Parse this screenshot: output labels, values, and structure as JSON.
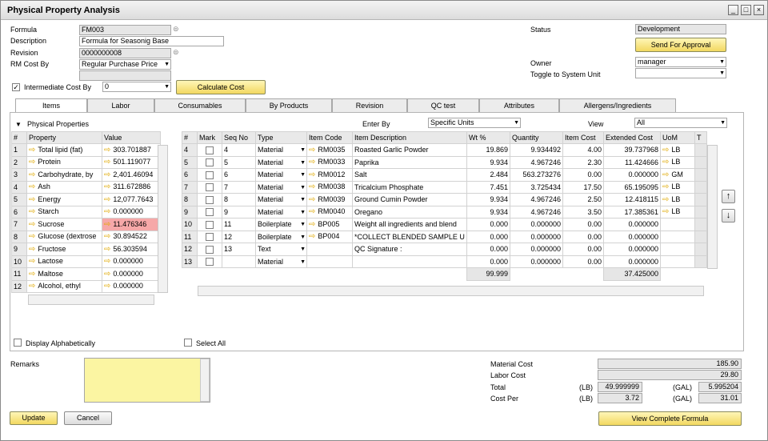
{
  "window": {
    "title": "Physical Property Analysis"
  },
  "header": {
    "formula_label": "Formula",
    "formula_value": "FM003",
    "description_label": "Description",
    "description_value": "Formula for Seasonig Base",
    "revision_label": "Revision",
    "revision_value": "0000000008",
    "rmcost_label": "RM Cost By",
    "rmcost_value": "Regular Purchase Price",
    "intermediate_label": "Intermediate Cost By",
    "intermediate_value": "0",
    "calc_button": "Calculate Cost",
    "status_label": "Status",
    "status_value": "Development",
    "send_button": "Send For Approval",
    "owner_label": "Owner",
    "owner_value": "manager",
    "toggle_label": "Toggle to System Unit",
    "toggle_value": ""
  },
  "tabs": [
    "Items",
    "Labor",
    "Consumables",
    "By Products",
    "Revision",
    "QC test",
    "Attributes",
    "Allergens/Ingredients"
  ],
  "props": {
    "section_label": "Physical Properties",
    "headers": [
      "#",
      "Property",
      "Value"
    ],
    "rows": [
      [
        "1",
        "Total lipid (fat)",
        "303.701887"
      ],
      [
        "2",
        "Protein",
        "501.119077"
      ],
      [
        "3",
        "Carbohydrate, by",
        "2,401.46094"
      ],
      [
        "4",
        "Ash",
        "311.672886"
      ],
      [
        "5",
        "Energy",
        "12,077.7643"
      ],
      [
        "6",
        "Starch",
        "0.000000"
      ],
      [
        "7",
        "Sucrose",
        "11.476346"
      ],
      [
        "8",
        "Glucose (dextrose",
        "30.894522"
      ],
      [
        "9",
        "Fructose",
        "56.303594"
      ],
      [
        "10",
        "Lactose",
        "0.000000"
      ],
      [
        "11",
        "Maltose",
        "0.000000"
      ],
      [
        "12",
        "Alcohol, ethyl",
        "0.000000"
      ]
    ],
    "display_alpha_label": "Display Alphabetically"
  },
  "items": {
    "enter_by_label": "Enter By",
    "enter_by_value": "Specific Units",
    "view_label": "View",
    "view_value": "All",
    "headers": [
      "#",
      "Mark",
      "Seq No",
      "Type",
      "Item Code",
      "Item Description",
      "Wt %",
      "Quantity",
      "Item Cost",
      "Extended Cost",
      "UoM",
      "T"
    ],
    "rows": [
      [
        "4",
        "",
        "4",
        "Material",
        "RM0035",
        "Roasted Garlic Powder",
        "19.869",
        "9.934492",
        "4.00",
        "39.737968",
        "LB"
      ],
      [
        "5",
        "",
        "5",
        "Material",
        "RM0033",
        "Paprika",
        "9.934",
        "4.967246",
        "2.30",
        "11.424666",
        "LB"
      ],
      [
        "6",
        "",
        "6",
        "Material",
        "RM0012",
        "Salt",
        "2.484",
        "563.273276",
        "0.00",
        "0.000000",
        "GM"
      ],
      [
        "7",
        "",
        "7",
        "Material",
        "RM0038",
        "Tricalcium Phosphate",
        "7.451",
        "3.725434",
        "17.50",
        "65.195095",
        "LB"
      ],
      [
        "8",
        "",
        "8",
        "Material",
        "RM0039",
        "Ground Cumin Powder",
        "9.934",
        "4.967246",
        "2.50",
        "12.418115",
        "LB"
      ],
      [
        "9",
        "",
        "9",
        "Material",
        "RM0040",
        "Oregano",
        "9.934",
        "4.967246",
        "3.50",
        "17.385361",
        "LB"
      ],
      [
        "10",
        "",
        "11",
        "Boilerplate",
        "BP005",
        "Weight all ingredients and blend",
        "0.000",
        "0.000000",
        "0.00",
        "0.000000",
        ""
      ],
      [
        "11",
        "",
        "12",
        "Boilerplate",
        "BP004",
        "*COLLECT BLENDED SAMPLE U",
        "0.000",
        "0.000000",
        "0.00",
        "0.000000",
        ""
      ],
      [
        "12",
        "",
        "13",
        "Text",
        "",
        "QC Signature :",
        "0.000",
        "0.000000",
        "0.00",
        "0.000000",
        ""
      ],
      [
        "13",
        "",
        "",
        "Material",
        "",
        "",
        "0.000",
        "0.000000",
        "0.00",
        "0.000000",
        ""
      ]
    ],
    "total_wt": "99.999",
    "total_ext": "37.425000",
    "select_all_label": "Select All"
  },
  "remarks": {
    "label": "Remarks",
    "value": ""
  },
  "costs": {
    "material_label": "Material Cost",
    "material_value": "185.90",
    "labor_label": "Labor Cost",
    "labor_value": "29.80",
    "total_label": "Total",
    "total_unit1": "(LB)",
    "total_value1": "49.999999",
    "total_unit2": "(GAL)",
    "total_value2": "5.995204",
    "costper_label": "Cost Per",
    "costper_unit1": "(LB)",
    "costper_value1": "3.72",
    "costper_unit2": "(GAL)",
    "costper_value2": "31.01"
  },
  "footer": {
    "update_button": "Update",
    "cancel_button": "Cancel",
    "view_formula_button": "View Complete Formula"
  }
}
